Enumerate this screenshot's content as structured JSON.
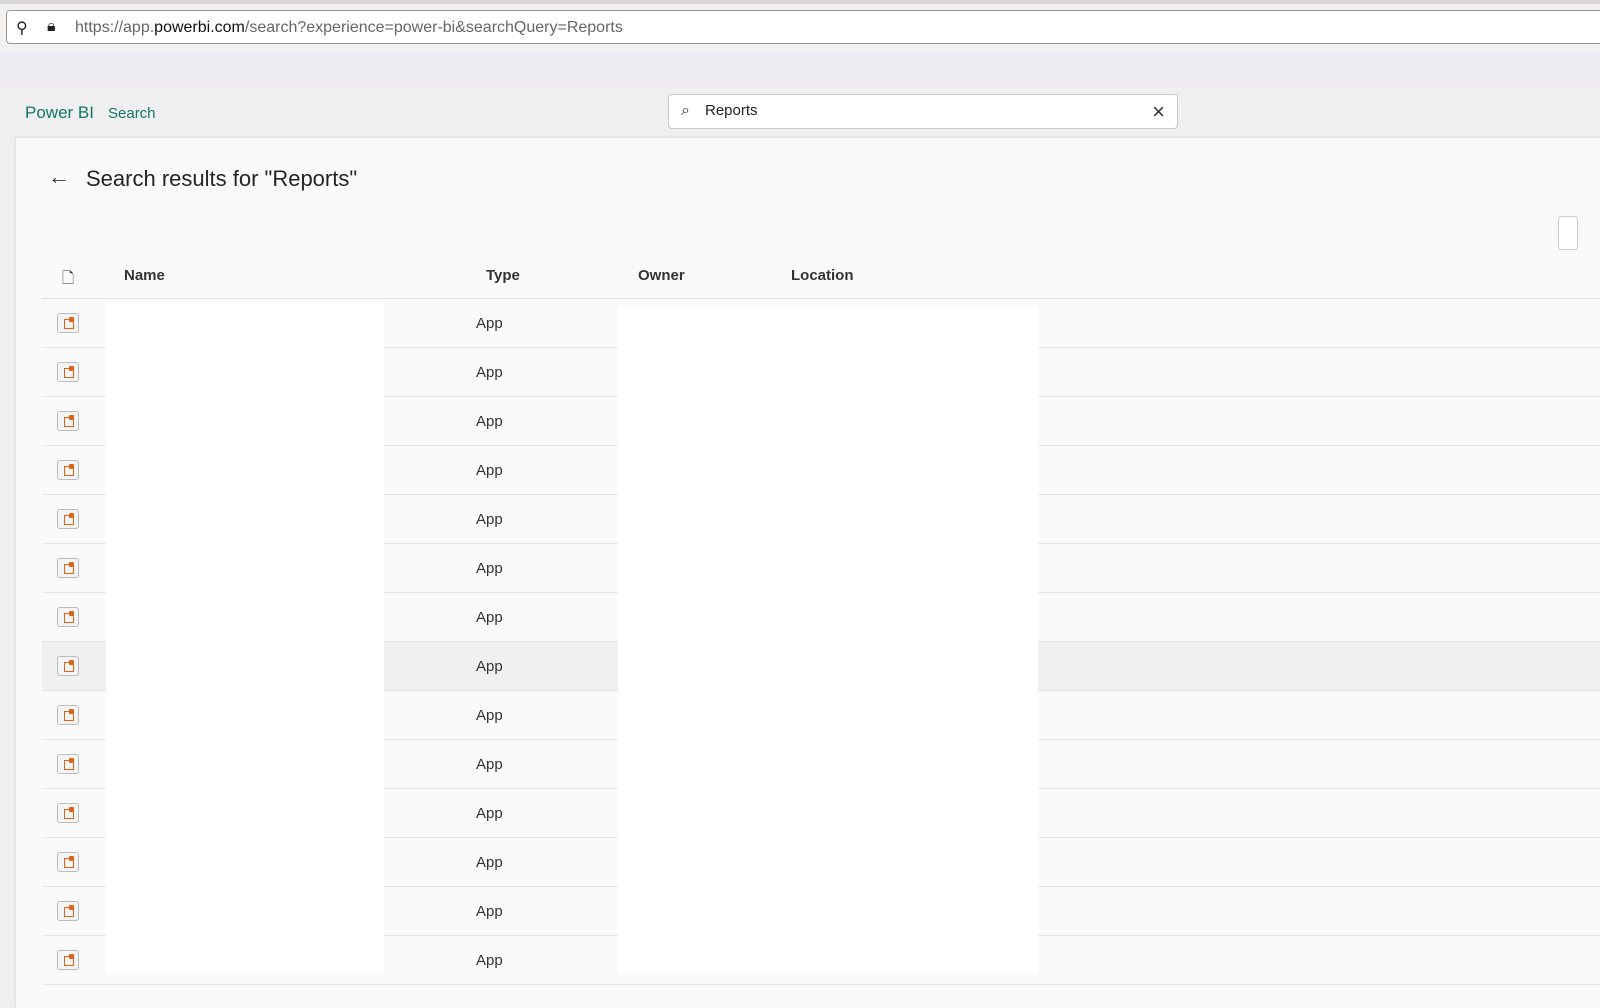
{
  "browser": {
    "url_prefix": "https://app.",
    "url_domain": "powerbi.com",
    "url_suffix": "/search?experience=power-bi&searchQuery=Reports"
  },
  "header": {
    "brand": "Power BI",
    "breadcrumb": "Search",
    "search_value": "Reports"
  },
  "page": {
    "title": "Search results for \"Reports\""
  },
  "table": {
    "columns": [
      "Name",
      "Type",
      "Owner",
      "Location"
    ],
    "rows": [
      {
        "type": "App"
      },
      {
        "type": "App"
      },
      {
        "type": "App"
      },
      {
        "type": "App"
      },
      {
        "type": "App"
      },
      {
        "type": "App"
      },
      {
        "type": "App"
      },
      {
        "type": "App",
        "highlighted": true
      },
      {
        "type": "App"
      },
      {
        "type": "App"
      },
      {
        "type": "App"
      },
      {
        "type": "App"
      },
      {
        "type": "App"
      },
      {
        "type": "App"
      }
    ]
  },
  "colors": {
    "brand": "#117865",
    "app_icon": "#d9651b"
  }
}
